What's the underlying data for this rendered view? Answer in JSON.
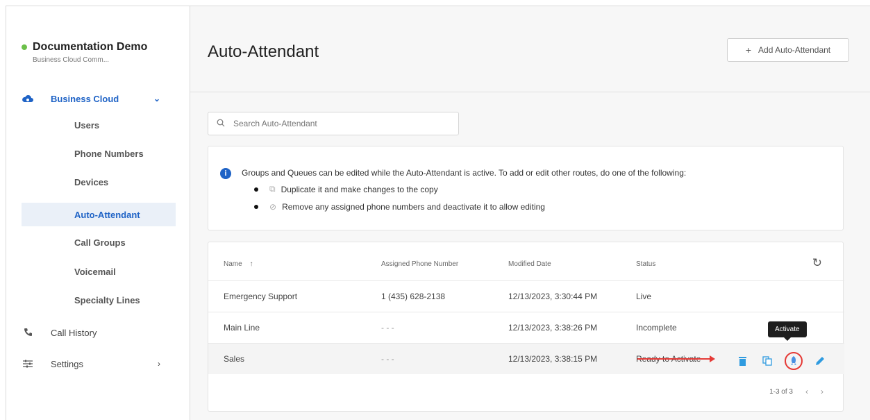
{
  "org": {
    "name": "Documentation Demo",
    "subtitle": "Business Cloud Comm..."
  },
  "nav": {
    "business_cloud": "Business Cloud",
    "sub_items": [
      "Users",
      "Phone Numbers",
      "Devices",
      "Auto-Attendant",
      "Call Groups",
      "Voicemail",
      "Specialty Lines"
    ],
    "active_item": "Auto-Attendant",
    "call_history": "Call History",
    "settings": "Settings"
  },
  "header": {
    "title": "Auto-Attendant",
    "add_button": "Add Auto-Attendant"
  },
  "search": {
    "placeholder": "Search Auto-Attendant"
  },
  "info": {
    "text": "Groups and Queues can be edited while the Auto-Attendant is active. To add or edit other routes, do one of the following:",
    "bullets": [
      "Duplicate it and make changes to the copy",
      "Remove any assigned phone numbers and deactivate it to allow editing"
    ]
  },
  "table": {
    "columns": [
      "Name",
      "Assigned Phone Number",
      "Modified Date",
      "Status"
    ],
    "rows": [
      {
        "name": "Emergency Support",
        "phone": "1 (435) 628-2138",
        "modified": "12/13/2023, 3:30:44 PM",
        "status": "Live"
      },
      {
        "name": "Main Line",
        "phone": "- - -",
        "modified": "12/13/2023, 3:38:26 PM",
        "status": "Incomplete"
      },
      {
        "name": "Sales",
        "phone": "- - -",
        "modified": "12/13/2023, 3:38:15 PM",
        "status": "Ready to Activate"
      }
    ],
    "tooltip": "Activate",
    "pagination": "1-3 of 3"
  },
  "colors": {
    "accent": "#1f63c6",
    "highlight": "#e53a36",
    "action": "#2f9be0"
  }
}
